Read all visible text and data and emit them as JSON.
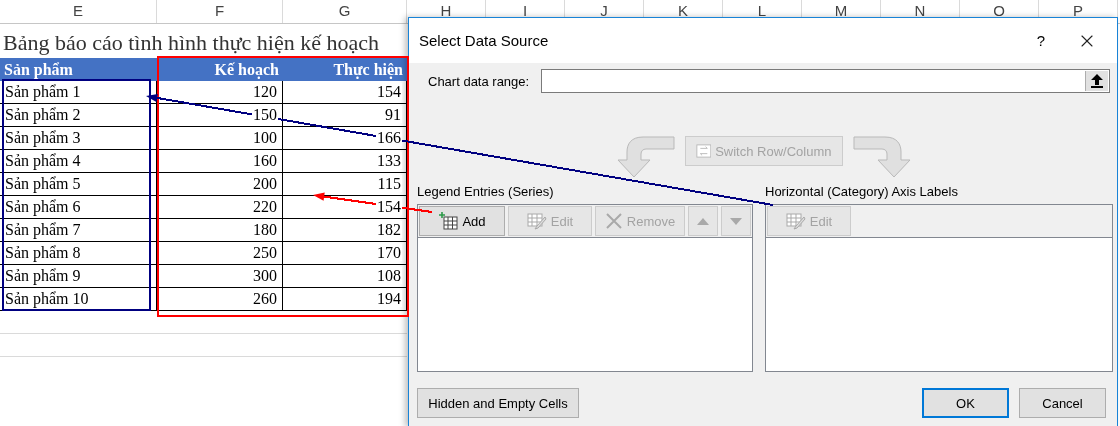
{
  "sheet": {
    "column_headers": [
      "E",
      "F",
      "G",
      "H",
      "I",
      "J",
      "K",
      "L",
      "M",
      "N",
      "O",
      "P"
    ],
    "title": "Bảng báo cáo tình hình thực hiện kế hoạch",
    "table": {
      "columns": [
        "Sản phẩm",
        "Kế hoạch",
        "Thực hiện"
      ],
      "rows": [
        [
          "Sản phẩm 1",
          "120",
          "154"
        ],
        [
          "Sản phẩm 2",
          "150",
          "91"
        ],
        [
          "Sản phẩm 3",
          "100",
          "166"
        ],
        [
          "Sản phẩm 4",
          "160",
          "133"
        ],
        [
          "Sản phẩm 5",
          "200",
          "115"
        ],
        [
          "Sản phẩm 6",
          "220",
          "154"
        ],
        [
          "Sản phẩm 7",
          "180",
          "182"
        ],
        [
          "Sản phẩm 8",
          "250",
          "170"
        ],
        [
          "Sản phẩm 9",
          "300",
          "108"
        ],
        [
          "Sản phẩm 10",
          "260",
          "194"
        ]
      ]
    }
  },
  "annotations": [
    {
      "kind": "frame",
      "color": "#000080"
    },
    {
      "kind": "frame",
      "color": "#ff0000"
    },
    {
      "kind": "arrow",
      "color": "#000080"
    },
    {
      "kind": "arrow",
      "color": "#ff0000"
    }
  ],
  "dialog": {
    "title": "Select Data Source",
    "help": "?",
    "data_range_label": "Chart data range:",
    "switch_button": {
      "label": "Switch Row/Column",
      "disabled": true
    },
    "series": {
      "label": "Legend Entries (Series)",
      "buttons": [
        {
          "kind": "add",
          "label": "Add",
          "disabled": false
        },
        {
          "kind": "edit",
          "label": "Edit",
          "disabled": true
        },
        {
          "kind": "remove",
          "label": "Remove",
          "disabled": true
        },
        {
          "kind": "up",
          "disabled": true
        },
        {
          "kind": "down",
          "disabled": true
        }
      ]
    },
    "categories": {
      "label": "Horizontal (Category) Axis Labels",
      "buttons": [
        {
          "kind": "edit",
          "label": "Edit",
          "disabled": true
        }
      ]
    },
    "hidden_cells_button": "Hidden and Empty Cells",
    "buttons": [
      {
        "label": "OK",
        "default": true
      },
      {
        "label": "Cancel",
        "default": false
      }
    ]
  }
}
